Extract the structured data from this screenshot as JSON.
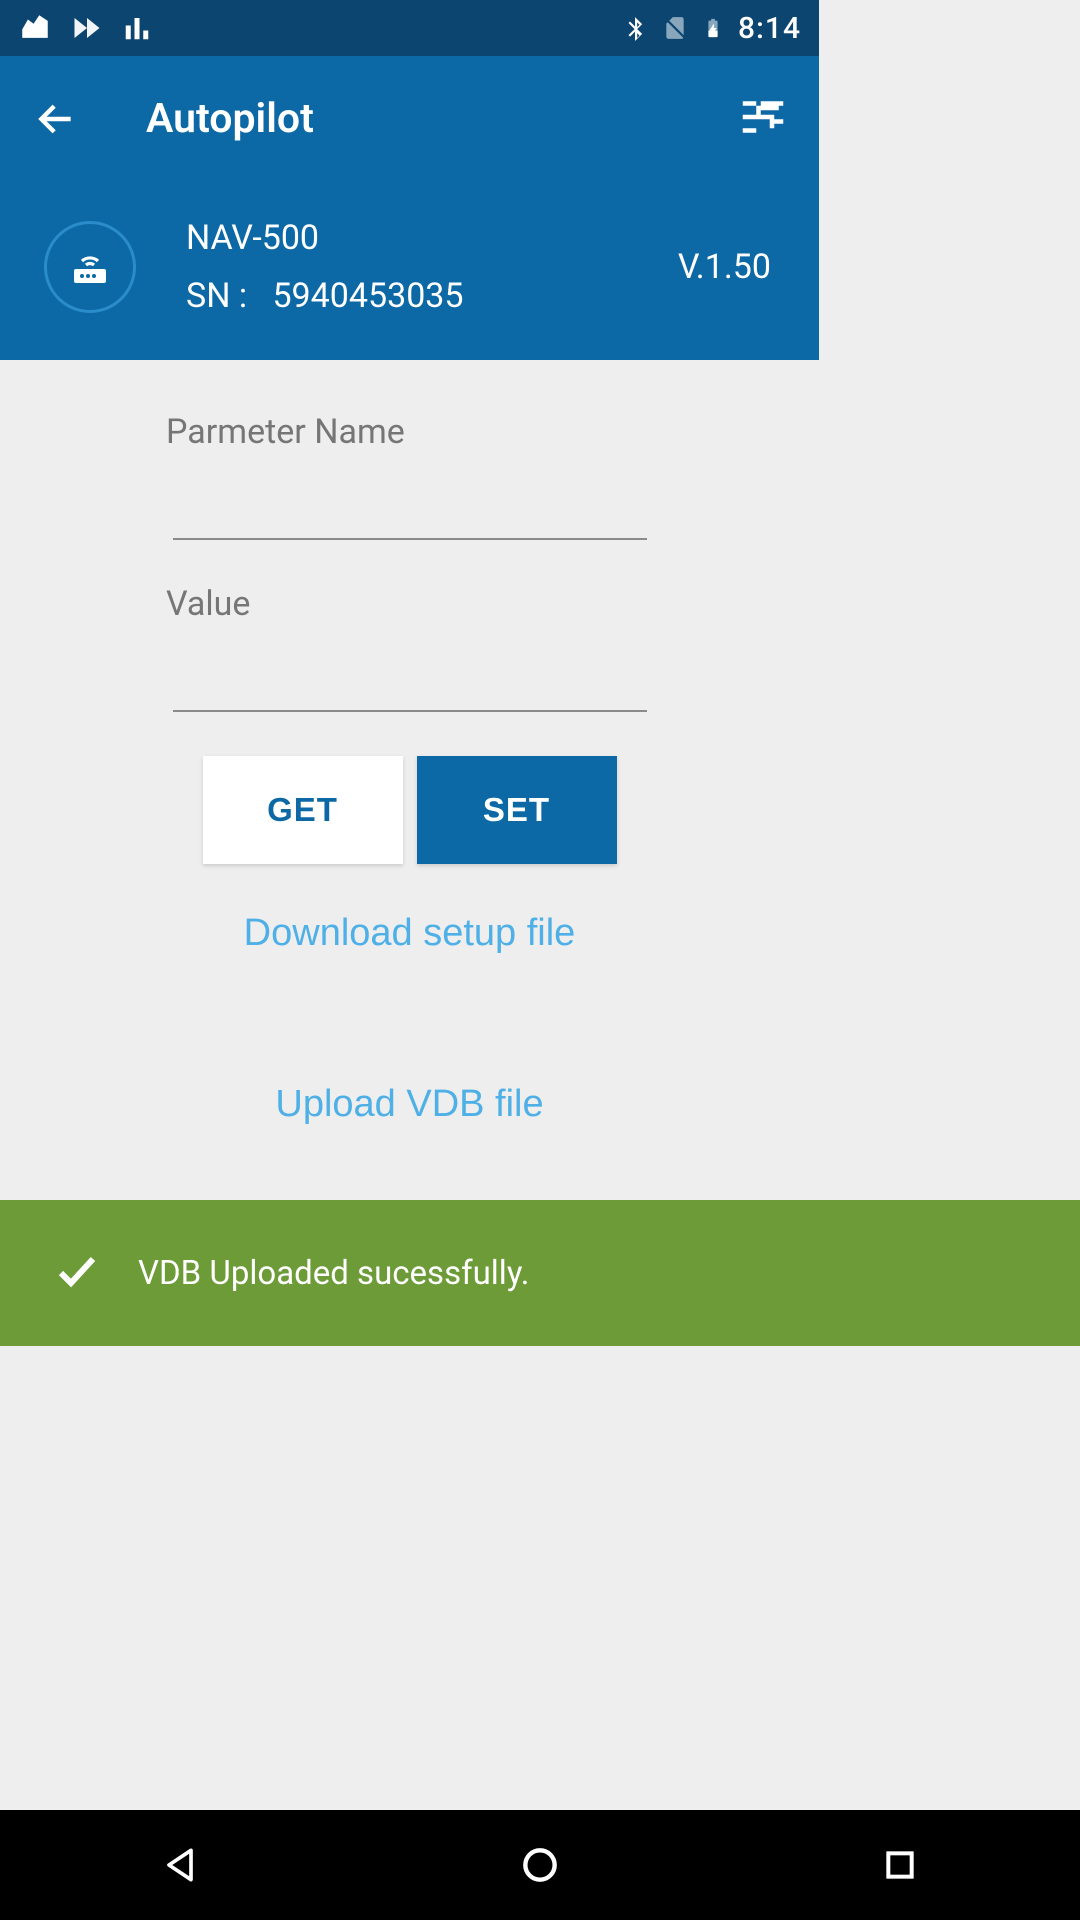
{
  "status_bar": {
    "time": "8:14"
  },
  "app_bar": {
    "title": "Autopilot"
  },
  "device": {
    "name": "NAV-500",
    "sn_label": "SN :",
    "sn_value": "5940453035",
    "version": "V.1.50"
  },
  "form": {
    "param_label": "Parmeter Name",
    "param_value": "",
    "value_label": "Value",
    "value_value": "",
    "get_label": "GET",
    "set_label": "SET",
    "download_label": "Download setup file",
    "upload_label": "Upload VDB file"
  },
  "toast": {
    "message": "VDB Uploaded sucessfully."
  }
}
